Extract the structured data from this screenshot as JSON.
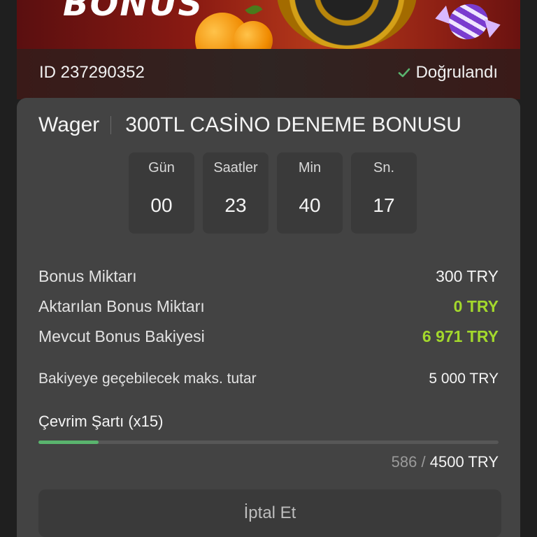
{
  "banner": {
    "text": "BONUS"
  },
  "account": {
    "id_text": "ID 237290352",
    "verified_label": "Doğrulandı",
    "check_color": "#5ab46e"
  },
  "wager": {
    "label": "Wager",
    "bonus_name": "300TL CASİNO DENEME BONUSU"
  },
  "timer": [
    {
      "label": "Gün",
      "value": "00"
    },
    {
      "label": "Saatler",
      "value": "23"
    },
    {
      "label": "Min",
      "value": "40"
    },
    {
      "label": "Sn.",
      "value": "17"
    }
  ],
  "details": [
    {
      "label": "Bonus Miktarı",
      "value": "300 TRY"
    },
    {
      "label": "Aktarılan Bonus Miktarı",
      "value": "0 TRY"
    },
    {
      "label": "Mevcut Bonus Bakiyesi",
      "value": "6 971 TRY"
    },
    {
      "label": "Bakiyeye geçebilecek maks. tutar",
      "value": "5 000 TRY"
    }
  ],
  "requirement": {
    "label": "Çevrim Şartı (x15)",
    "current": "586",
    "separator": "/",
    "total": "4500 TRY",
    "progress_fraction": 0.13
  },
  "colors": {
    "accent_green": "#a3d82c",
    "progress_green": "#5ab46e",
    "card_bg": "#434343"
  },
  "cancel_button": {
    "label": "İptal Et"
  }
}
